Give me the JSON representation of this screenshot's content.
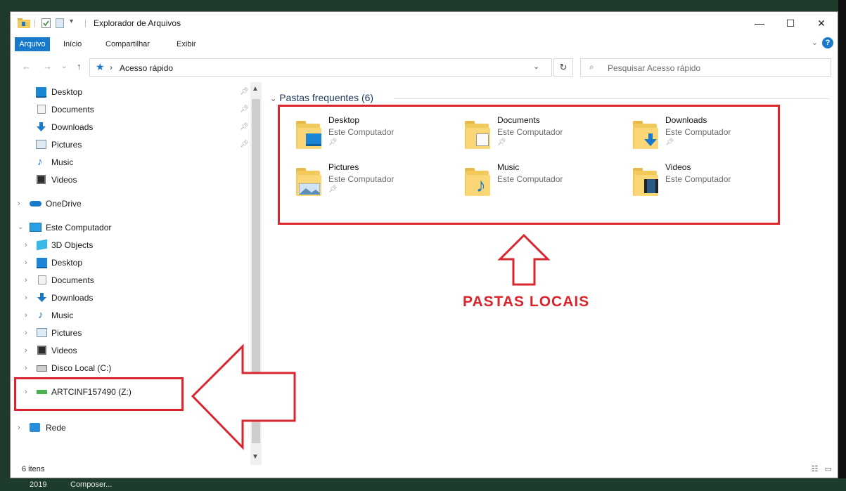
{
  "window": {
    "title": "Explorador de Arquivos",
    "minimize": "—",
    "maximize": "☐",
    "close": "✕"
  },
  "ribbon": {
    "tabs": [
      "Arquivo",
      "Início",
      "Compartilhar",
      "Exibir"
    ],
    "expand": "⌄",
    "help": "?"
  },
  "address_bar": {
    "back": "←",
    "forward": "→",
    "recent": "⌄",
    "up": "↑",
    "location": "Acesso rápido",
    "separator": "›",
    "dropdown": "⌄",
    "refresh": "↻",
    "search_placeholder": "Pesquisar Acesso rápido"
  },
  "nav_pane": {
    "quick_access": [
      "Desktop",
      "Documents",
      "Downloads",
      "Pictures",
      "Music",
      "Videos"
    ],
    "onedrive": "OneDrive",
    "this_pc": "Este Computador",
    "this_pc_items": [
      "3D Objects",
      "Desktop",
      "Documents",
      "Downloads",
      "Music",
      "Pictures",
      "Videos",
      "Disco Local (C:)"
    ],
    "network_drive": "ARTCINF157490 (Z:)",
    "network": "Rede"
  },
  "content": {
    "group_title": "Pastas frequentes (6)",
    "folders": [
      {
        "name": "Desktop",
        "location": "Este Computador",
        "pinned": true,
        "icon": "desktop-folder-icon"
      },
      {
        "name": "Documents",
        "location": "Este Computador",
        "pinned": true,
        "icon": "documents-folder-icon"
      },
      {
        "name": "Downloads",
        "location": "Este Computador",
        "pinned": true,
        "icon": "downloads-folder-icon"
      },
      {
        "name": "Pictures",
        "location": "Este Computador",
        "pinned": true,
        "icon": "pictures-folder-icon"
      },
      {
        "name": "Music",
        "location": "Este Computador",
        "pinned": false,
        "icon": "music-folder-icon"
      },
      {
        "name": "Videos",
        "location": "Este Computador",
        "pinned": false,
        "icon": "videos-folder-icon"
      }
    ]
  },
  "annotation": {
    "label": "PASTAS LOCAIS",
    "color": "#d7262e"
  },
  "status_bar": {
    "item_count": "6 itens"
  },
  "taskbar": {
    "items": [
      "2019",
      "Composer..."
    ]
  },
  "colors": {
    "accent": "#1979ca",
    "folder": "#f9d776"
  }
}
